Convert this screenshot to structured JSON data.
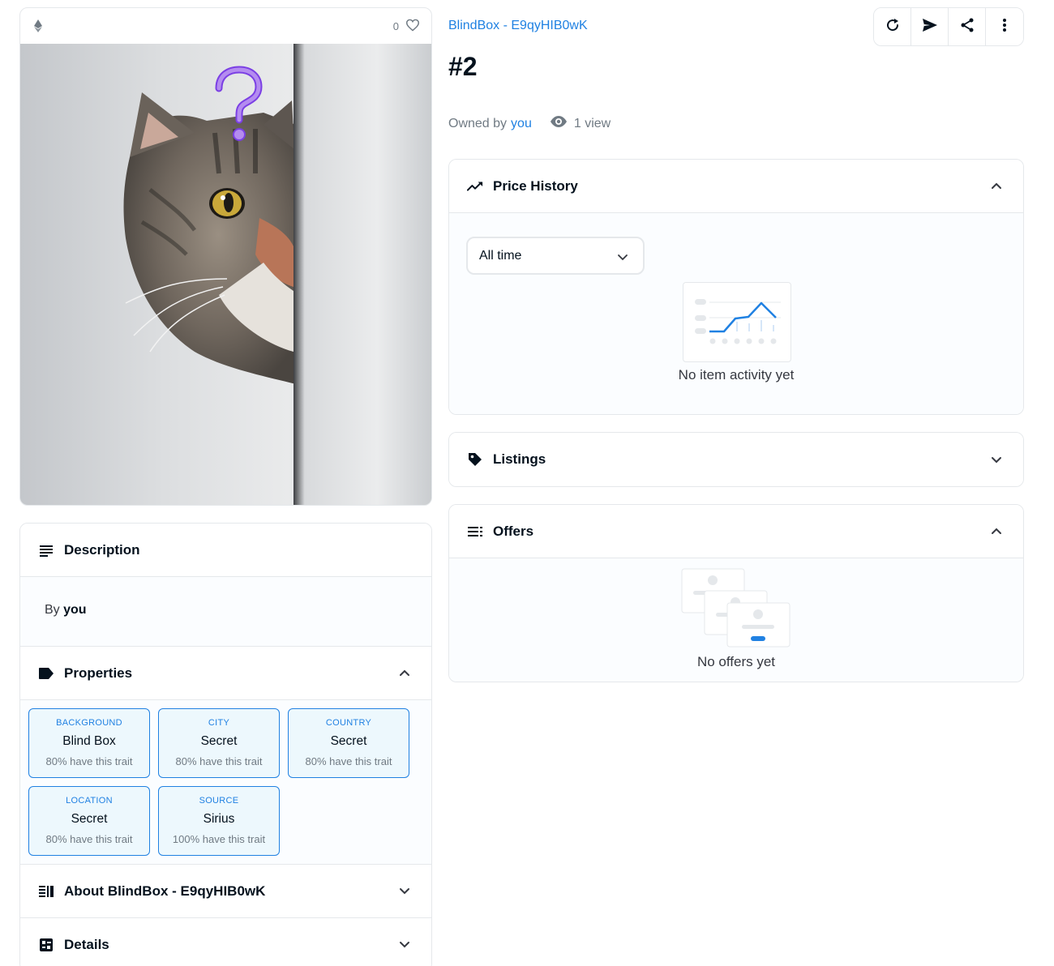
{
  "media": {
    "chain_icon": "ethereum-icon",
    "favorites_count": "0",
    "favorite_icon": "heart-icon",
    "image_alt": "tabby cat peeking around a wall with a purple question mark"
  },
  "description": {
    "title": "Description",
    "by_prefix": "By",
    "creator": "you"
  },
  "properties": {
    "title": "Properties",
    "traits": [
      {
        "type": "BACKGROUND",
        "value": "Blind Box",
        "rarity": "80% have this trait"
      },
      {
        "type": "CITY",
        "value": "Secret",
        "rarity": "80% have this trait"
      },
      {
        "type": "COUNTRY",
        "value": "Secret",
        "rarity": "80% have this trait"
      },
      {
        "type": "LOCATION",
        "value": "Secret",
        "rarity": "80% have this trait"
      },
      {
        "type": "SOURCE",
        "value": "Sirius",
        "rarity": "100% have this trait"
      }
    ]
  },
  "about": {
    "title": "About BlindBox - E9qyHIB0wK"
  },
  "details": {
    "title": "Details"
  },
  "header": {
    "collection": "BlindBox - E9qyHIB0wK",
    "item_name": "#2",
    "owned_by": "Owned by",
    "owner": "you",
    "views": "1 view"
  },
  "toolbar": {
    "refresh_icon": "refresh-icon",
    "transfer_icon": "send-icon",
    "share_icon": "share-icon",
    "more_icon": "more-vertical-icon"
  },
  "price_history": {
    "title": "Price History",
    "range": "All time",
    "empty": "No item activity yet"
  },
  "listings": {
    "title": "Listings"
  },
  "offers": {
    "title": "Offers",
    "empty": "No offers yet"
  },
  "colors": {
    "accent": "#2081e2",
    "text_dark": "#04111d",
    "border": "#e5e8eb",
    "muted": "#707a83"
  }
}
